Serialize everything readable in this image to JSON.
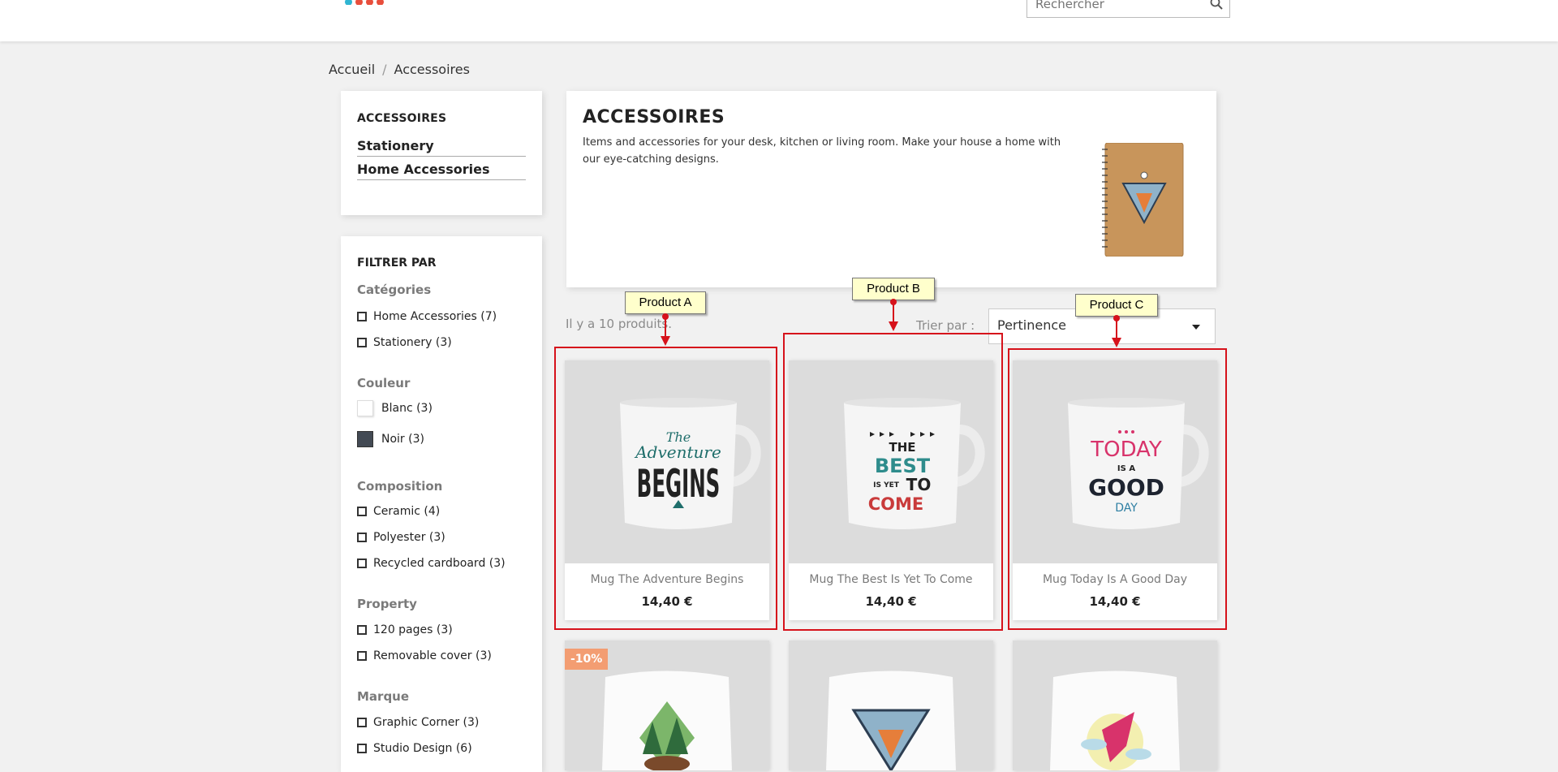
{
  "header": {
    "search_placeholder": "Rechercher"
  },
  "breadcrumb": {
    "home": "Accueil",
    "separator": "/",
    "current": "Accessoires"
  },
  "category_panel": {
    "title": "ACCESSOIRES",
    "links": [
      "Stationery",
      "Home Accessories"
    ]
  },
  "filters": {
    "title": "FILTRER PAR",
    "groups": [
      {
        "heading": "Catégories",
        "items": [
          "Home Accessories (7)",
          "Stationery (3)"
        ]
      },
      {
        "heading": "Couleur",
        "items": [
          "Blanc (3)",
          "Noir (3)"
        ]
      },
      {
        "heading": "Composition",
        "items": [
          "Ceramic (4)",
          "Polyester (3)",
          "Recycled cardboard (3)"
        ]
      },
      {
        "heading": "Property",
        "items": [
          "120 pages (3)",
          "Removable cover (3)"
        ]
      },
      {
        "heading": "Marque",
        "items": [
          "Graphic Corner (3)",
          "Studio Design (6)"
        ]
      }
    ]
  },
  "hero": {
    "title": "ACCESSOIRES",
    "description": "Items and accessories for your desk, kitchen or living room. Make your house a home with our eye-catching designs."
  },
  "listing": {
    "count_text": "Il y a 10 produits.",
    "sort_label": "Trier par :",
    "sort_value": "Pertinence"
  },
  "products": [
    {
      "name": "Mug The Adventure Begins",
      "price": "14,40 €",
      "mug_lines": [
        "The",
        "Adventure",
        "BEGINS"
      ]
    },
    {
      "name": "Mug The Best Is Yet To Come",
      "price": "14,40 €",
      "mug_lines": [
        "THE",
        "BEST",
        "IS YET",
        "TO",
        "COME"
      ]
    },
    {
      "name": "Mug Today Is A Good Day",
      "price": "14,40 €",
      "mug_lines": [
        "TODAY",
        "IS A",
        "GOOD",
        "DAY"
      ]
    }
  ],
  "second_row": {
    "badge": "-10%"
  },
  "annotations": [
    "Product A",
    "Product B",
    "Product C"
  ],
  "colors": {
    "accent_red": "#d6121b",
    "callout_bg": "#ffffcc",
    "badge": "#f39d72",
    "swatch_black": "#434a54"
  }
}
